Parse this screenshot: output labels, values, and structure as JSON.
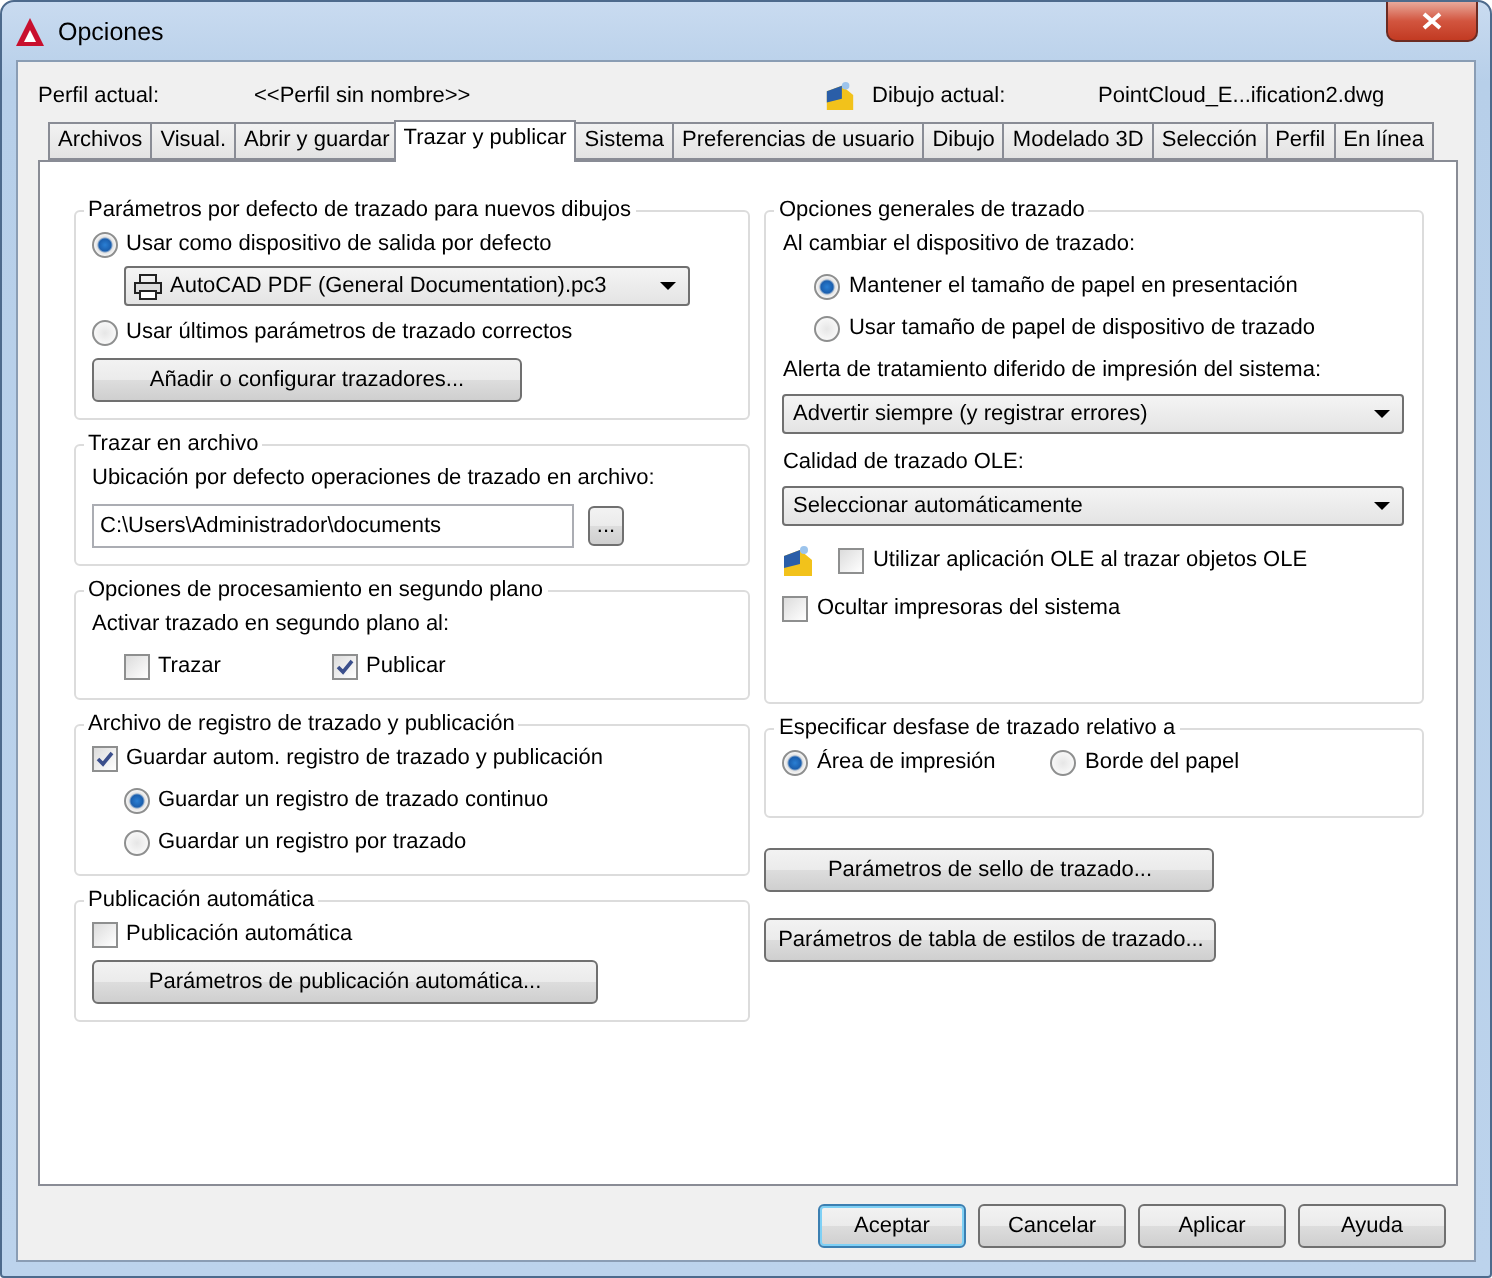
{
  "window": {
    "title": "Opciones"
  },
  "profile": {
    "label": "Perfil actual:",
    "value": "<<Perfil sin nombre>>"
  },
  "drawing": {
    "label": "Dibujo actual:",
    "value": "PointCloud_E...ification2.dwg"
  },
  "tabs": [
    {
      "label": "Archivos",
      "selected": false
    },
    {
      "label": "Visual.",
      "selected": false
    },
    {
      "label": "Abrir y guardar",
      "selected": false
    },
    {
      "label": "Trazar y publicar",
      "selected": true
    },
    {
      "label": "Sistema",
      "selected": false
    },
    {
      "label": "Preferencias de usuario",
      "selected": false
    },
    {
      "label": "Dibujo",
      "selected": false
    },
    {
      "label": "Modelado 3D",
      "selected": false
    },
    {
      "label": "Selección",
      "selected": false
    },
    {
      "label": "Perfil",
      "selected": false
    },
    {
      "label": "En línea",
      "selected": false
    }
  ],
  "left_column": [
    {
      "title": "Parámetros por defecto de trazado para nuevos dibujos",
      "items": [
        {
          "kind": "radio",
          "label": "Usar como dispositivo de salida por defecto",
          "selected": true
        },
        {
          "kind": "printer-dropdown",
          "value": "AutoCAD PDF (General Documentation).pc3"
        },
        {
          "kind": "radio",
          "label": "Usar últimos parámetros de trazado correctos",
          "selected": false
        },
        {
          "kind": "button",
          "label": "Añadir o configurar trazadores..."
        }
      ]
    },
    {
      "title": "Trazar en archivo",
      "items": [
        {
          "kind": "label",
          "label": "Ubicación por defecto operaciones de trazado en archivo:"
        },
        {
          "kind": "path",
          "value": "C:\\Users\\Administrador\\documents",
          "browse": "..."
        }
      ]
    },
    {
      "title": "Opciones de procesamiento en segundo plano",
      "items": [
        {
          "kind": "label",
          "label": "Activar trazado en segundo plano al:"
        },
        {
          "kind": "row",
          "items": [
            {
              "kind": "checkbox",
              "label": "Trazar",
              "checked": false
            },
            {
              "kind": "checkbox",
              "label": "Publicar",
              "checked": true
            }
          ]
        }
      ]
    },
    {
      "title": "Archivo de registro de trazado y publicación",
      "items": [
        {
          "kind": "checkbox",
          "label": "Guardar autom. registro de trazado y publicación",
          "checked": true,
          "children": [
            {
              "kind": "radio",
              "label": "Guardar un registro de trazado continuo",
              "selected": true
            },
            {
              "kind": "radio",
              "label": "Guardar un registro por trazado",
              "selected": false
            }
          ]
        }
      ]
    },
    {
      "title": "Publicación automática",
      "items": [
        {
          "kind": "checkbox",
          "label": "Publicación automática",
          "checked": false
        },
        {
          "kind": "button",
          "label": "Parámetros de publicación automática..."
        }
      ]
    }
  ],
  "right_column": [
    {
      "title": "Opciones generales de trazado",
      "items": [
        {
          "kind": "label",
          "label": "Al cambiar el dispositivo de trazado:",
          "children": [
            {
              "kind": "radio",
              "label": "Mantener el tamaño de papel en presentación",
              "selected": true
            },
            {
              "kind": "radio",
              "label": "Usar tamaño de papel de dispositivo de trazado",
              "selected": false
            }
          ]
        },
        {
          "kind": "label",
          "label": "Alerta de tratamiento diferido de impresión del sistema:"
        },
        {
          "kind": "dropdown",
          "value": "Advertir siempre (y registrar errores)"
        },
        {
          "kind": "label",
          "label": "Calidad de trazado OLE:"
        },
        {
          "kind": "dropdown",
          "value": "Seleccionar automáticamente"
        },
        {
          "kind": "icon-checkbox",
          "label": "Utilizar aplicación OLE al trazar objetos OLE",
          "checked": false
        },
        {
          "kind": "checkbox",
          "label": "Ocultar impresoras del sistema",
          "checked": false
        }
      ]
    },
    {
      "title": "Especificar desfase de trazado relativo a",
      "items": [
        {
          "kind": "row",
          "items": [
            {
              "kind": "radio",
              "label": "Área de impresión",
              "selected": true
            },
            {
              "kind": "radio",
              "label": "Borde del papel",
              "selected": false
            }
          ]
        }
      ]
    }
  ],
  "right_buttons": [
    "Parámetros de sello de trazado...",
    "Parámetros de tabla de estilos de trazado..."
  ],
  "dialog_buttons": [
    "Aceptar",
    "Cancelar",
    "Aplicar",
    "Ayuda"
  ]
}
